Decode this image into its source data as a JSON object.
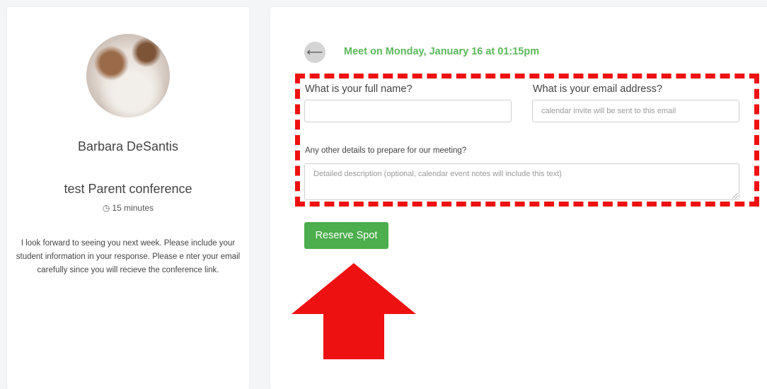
{
  "profile": {
    "host_name": "Barbara DeSantis",
    "event_name": "test Parent conference",
    "duration_icon": "clock-icon",
    "duration": "15 minutes",
    "description": "I look forward to seeing you next week. Please include your student information in your response. Please e nter your email carefully since you will recieve the conference link."
  },
  "booking": {
    "back_icon": "arrow-left-icon",
    "meet_heading": "Meet on Monday, January 16 at 01:15pm",
    "name_label": "What is your full name?",
    "name_value": "",
    "email_label": "What is your email address?",
    "email_placeholder": "calendar invite will be sent to this email",
    "details_label": "Any other details to prepare for our meeting?",
    "details_placeholder": "Detailed description (optional, calendar event notes will include this text)",
    "reserve_label": "Reserve Spot"
  },
  "annotations": {
    "highlight_color": "#ee1111",
    "accent_green": "#5cb85c"
  }
}
